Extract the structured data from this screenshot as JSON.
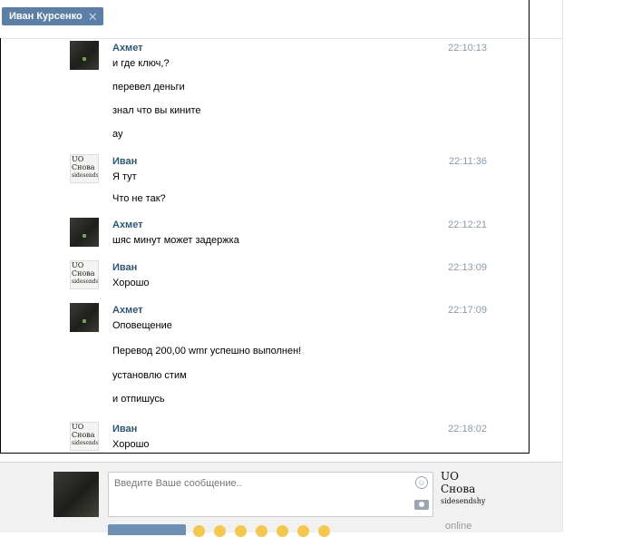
{
  "tab": {
    "title": "Иван Курсенко",
    "close_glyph": "✕"
  },
  "messages": [
    {
      "author": "Ахмет",
      "avatar": "dark-photo",
      "time": "22:10:13",
      "lines": [
        "и где ключ,?",
        "перевел деньги",
        "знал что вы кините",
        "ау"
      ]
    },
    {
      "author": "Иван",
      "avatar": "sketch",
      "time": "22:11:36",
      "lines": [
        "Я тут",
        "Что не так?"
      ]
    },
    {
      "author": "Ахмет",
      "avatar": "dark-photo",
      "time": "22:12:21",
      "lines": [
        "шяс минут может задержка"
      ]
    },
    {
      "author": "Иван",
      "avatar": "sketch",
      "time": "22:13:09",
      "lines": [
        "Хорошо"
      ]
    },
    {
      "author": "Ахмет",
      "avatar": "dark-photo",
      "time": "22:17:09",
      "lines": [
        "Оповещение",
        "Перевод 200,00 wmr успешно выполнен!",
        "установлю стим",
        "и отпишусь"
      ]
    },
    {
      "author": "Иван",
      "avatar": "sketch",
      "time": "22:18:02",
      "lines": [
        "Хорошо"
      ]
    }
  ],
  "avatar_sketch_text": [
    "UO",
    "Снова",
    "sidesendshy"
  ],
  "composer": {
    "placeholder": "Введите Ваше сообщение..",
    "smile_icon": "smile-icon",
    "camera_icon": "camera-icon",
    "status": "online"
  },
  "colors": {
    "tab_bg": "#5b7fa6",
    "author": "#2b587a",
    "time": "#8c9aa9"
  }
}
